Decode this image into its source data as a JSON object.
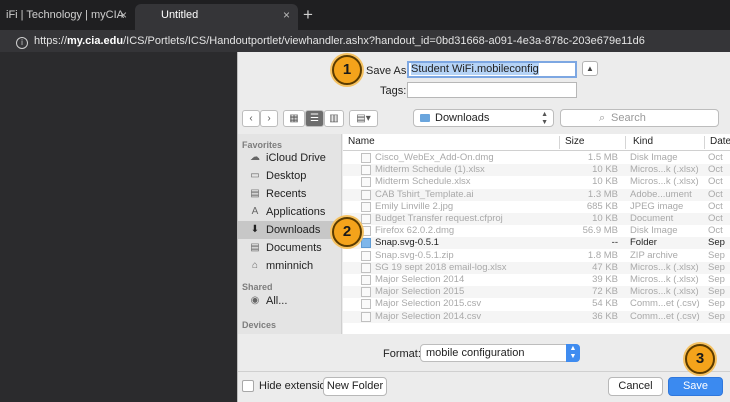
{
  "browser": {
    "tabs": [
      {
        "label": "iFi | Technology | myCIA",
        "close": "×"
      },
      {
        "label": "Untitled",
        "close": "×"
      }
    ],
    "new_tab": "+",
    "info_icon": "i",
    "url_prefix": "https://",
    "url_domain": "my.cia.edu",
    "url_path": "/ICS/Portlets/ICS/Handoutportlet/viewhandler.ashx?handout_id=0bd31668-a091-4e3a-878c-203e679e11d6"
  },
  "dialog": {
    "save_as_label": "Save As:",
    "save_as_value": "Student WiFi.mobileconfig",
    "tags_label": "Tags:",
    "tags_value": "",
    "location": "Downloads",
    "search_placeholder": "Search",
    "toolbar": {
      "back": "‹",
      "forward": "›",
      "icon_view": "▦",
      "list_view": "☰",
      "column_view": "▥",
      "gallery_view": "▤▾",
      "collapse": "▲"
    }
  },
  "sidebar": {
    "favorites_header": "Favorites",
    "favorites": [
      {
        "label": "iCloud Drive",
        "icon": "☁"
      },
      {
        "label": "Desktop",
        "icon": "▭"
      },
      {
        "label": "Recents",
        "icon": "▤"
      },
      {
        "label": "Applications",
        "icon": "A"
      },
      {
        "label": "Downloads",
        "icon": "⬇"
      },
      {
        "label": "Documents",
        "icon": "▤"
      },
      {
        "label": "mminnich",
        "icon": "⌂"
      }
    ],
    "shared_header": "Shared",
    "shared": [
      {
        "label": "All...",
        "icon": "◉"
      }
    ],
    "devices_header": "Devices"
  },
  "filelist": {
    "columns": {
      "name": "Name",
      "size": "Size",
      "kind": "Kind",
      "date": "Date"
    },
    "rows": [
      {
        "name": "Cisco_WebEx_Add-On.dmg",
        "size": "1.5 MB",
        "kind": "Disk Image",
        "date": "Oct"
      },
      {
        "name": "Midterm Schedule (1).xlsx",
        "size": "10 KB",
        "kind": "Micros...k (.xlsx)",
        "date": "Oct"
      },
      {
        "name": "Midterm Schedule.xlsx",
        "size": "10 KB",
        "kind": "Micros...k (.xlsx)",
        "date": "Oct"
      },
      {
        "name": "CAB Tshirt_Template.ai",
        "size": "1.3 MB",
        "kind": "Adobe...ument",
        "date": "Oct"
      },
      {
        "name": "Emily Linville 2.jpg",
        "size": "685 KB",
        "kind": "JPEG image",
        "date": "Oct"
      },
      {
        "name": "Budget Transfer request.cfproj",
        "size": "10 KB",
        "kind": "Document",
        "date": "Oct"
      },
      {
        "name": "Firefox 62.0.2.dmg",
        "size": "56.9 MB",
        "kind": "Disk Image",
        "date": "Oct"
      },
      {
        "name": "Snap.svg-0.5.1",
        "size": "--",
        "kind": "Folder",
        "date": "Sep"
      },
      {
        "name": "Snap.svg-0.5.1.zip",
        "size": "1.8 MB",
        "kind": "ZIP archive",
        "date": "Sep"
      },
      {
        "name": "SG 19 sept 2018 email-log.xlsx",
        "size": "47 KB",
        "kind": "Micros...k (.xlsx)",
        "date": "Sep"
      },
      {
        "name": "Major Selection 2014",
        "size": "39 KB",
        "kind": "Micros...k (.xlsx)",
        "date": "Sep"
      },
      {
        "name": "Major Selection 2015",
        "size": "72 KB",
        "kind": "Micros...k (.xlsx)",
        "date": "Sep"
      },
      {
        "name": "Major Selection 2015.csv",
        "size": "54 KB",
        "kind": "Comm...et (.csv)",
        "date": "Sep"
      },
      {
        "name": "Major Selection 2014.csv",
        "size": "36 KB",
        "kind": "Comm...et (.csv)",
        "date": "Sep"
      }
    ]
  },
  "format": {
    "label": "Format:",
    "value": "mobile configuration",
    "chevron": "▲▼"
  },
  "footer": {
    "hide_extension": "Hide extension",
    "new_folder": "New Folder",
    "cancel": "Cancel",
    "save": "Save"
  },
  "steps": [
    "1",
    "2",
    "3"
  ]
}
